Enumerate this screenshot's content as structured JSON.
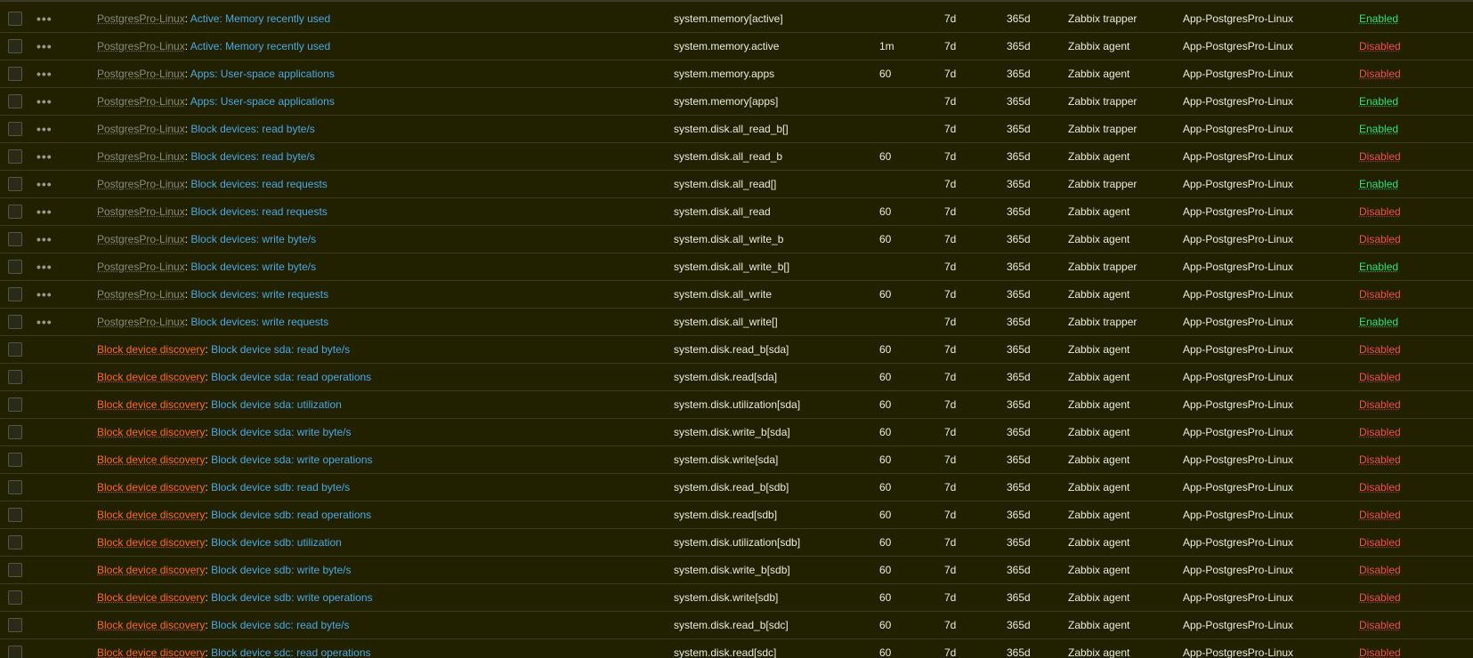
{
  "colors": {
    "background": "#212100",
    "link": "#4ea8e0",
    "discovery": "#ff6a1a",
    "template": "#8a8a80",
    "enabled": "#2ee37a",
    "disabled": "#f24f4f"
  },
  "icons": {
    "row_menu": "ellipsis-icon"
  },
  "rows": [
    {
      "prefix": "PostgresPro-Linux",
      "prefix_kind": "template",
      "has_menu": true,
      "name": "Active: Memory recently used",
      "key": "system.memory[active]",
      "interval": "",
      "history": "7d",
      "trends": "365d",
      "type": "Zabbix trapper",
      "application": "App-PostgresPro-Linux",
      "status": "Enabled"
    },
    {
      "prefix": "PostgresPro-Linux",
      "prefix_kind": "template",
      "has_menu": true,
      "name": "Active: Memory recently used",
      "key": "system.memory.active",
      "interval": "1m",
      "history": "7d",
      "trends": "365d",
      "type": "Zabbix agent",
      "application": "App-PostgresPro-Linux",
      "status": "Disabled"
    },
    {
      "prefix": "PostgresPro-Linux",
      "prefix_kind": "template",
      "has_menu": true,
      "name": "Apps: User-space applications",
      "key": "system.memory.apps",
      "interval": "60",
      "history": "7d",
      "trends": "365d",
      "type": "Zabbix agent",
      "application": "App-PostgresPro-Linux",
      "status": "Disabled"
    },
    {
      "prefix": "PostgresPro-Linux",
      "prefix_kind": "template",
      "has_menu": true,
      "name": "Apps: User-space applications",
      "key": "system.memory[apps]",
      "interval": "",
      "history": "7d",
      "trends": "365d",
      "type": "Zabbix trapper",
      "application": "App-PostgresPro-Linux",
      "status": "Enabled"
    },
    {
      "prefix": "PostgresPro-Linux",
      "prefix_kind": "template",
      "has_menu": true,
      "name": "Block devices: read byte/s",
      "key": "system.disk.all_read_b[]",
      "interval": "",
      "history": "7d",
      "trends": "365d",
      "type": "Zabbix trapper",
      "application": "App-PostgresPro-Linux",
      "status": "Enabled"
    },
    {
      "prefix": "PostgresPro-Linux",
      "prefix_kind": "template",
      "has_menu": true,
      "name": "Block devices: read byte/s",
      "key": "system.disk.all_read_b",
      "interval": "60",
      "history": "7d",
      "trends": "365d",
      "type": "Zabbix agent",
      "application": "App-PostgresPro-Linux",
      "status": "Disabled"
    },
    {
      "prefix": "PostgresPro-Linux",
      "prefix_kind": "template",
      "has_menu": true,
      "name": "Block devices: read requests",
      "key": "system.disk.all_read[]",
      "interval": "",
      "history": "7d",
      "trends": "365d",
      "type": "Zabbix trapper",
      "application": "App-PostgresPro-Linux",
      "status": "Enabled"
    },
    {
      "prefix": "PostgresPro-Linux",
      "prefix_kind": "template",
      "has_menu": true,
      "name": "Block devices: read requests",
      "key": "system.disk.all_read",
      "interval": "60",
      "history": "7d",
      "trends": "365d",
      "type": "Zabbix agent",
      "application": "App-PostgresPro-Linux",
      "status": "Disabled"
    },
    {
      "prefix": "PostgresPro-Linux",
      "prefix_kind": "template",
      "has_menu": true,
      "name": "Block devices: write byte/s",
      "key": "system.disk.all_write_b",
      "interval": "60",
      "history": "7d",
      "trends": "365d",
      "type": "Zabbix agent",
      "application": "App-PostgresPro-Linux",
      "status": "Disabled"
    },
    {
      "prefix": "PostgresPro-Linux",
      "prefix_kind": "template",
      "has_menu": true,
      "name": "Block devices: write byte/s",
      "key": "system.disk.all_write_b[]",
      "interval": "",
      "history": "7d",
      "trends": "365d",
      "type": "Zabbix trapper",
      "application": "App-PostgresPro-Linux",
      "status": "Enabled"
    },
    {
      "prefix": "PostgresPro-Linux",
      "prefix_kind": "template",
      "has_menu": true,
      "name": "Block devices: write requests",
      "key": "system.disk.all_write",
      "interval": "60",
      "history": "7d",
      "trends": "365d",
      "type": "Zabbix agent",
      "application": "App-PostgresPro-Linux",
      "status": "Disabled"
    },
    {
      "prefix": "PostgresPro-Linux",
      "prefix_kind": "template",
      "has_menu": true,
      "name": "Block devices: write requests",
      "key": "system.disk.all_write[]",
      "interval": "",
      "history": "7d",
      "trends": "365d",
      "type": "Zabbix trapper",
      "application": "App-PostgresPro-Linux",
      "status": "Enabled"
    },
    {
      "prefix": "Block device discovery",
      "prefix_kind": "discovery",
      "has_menu": false,
      "name": "Block device sda: read byte/s",
      "key": "system.disk.read_b[sda]",
      "interval": "60",
      "history": "7d",
      "trends": "365d",
      "type": "Zabbix agent",
      "application": "App-PostgresPro-Linux",
      "status": "Disabled"
    },
    {
      "prefix": "Block device discovery",
      "prefix_kind": "discovery",
      "has_menu": false,
      "name": "Block device sda: read operations",
      "key": "system.disk.read[sda]",
      "interval": "60",
      "history": "7d",
      "trends": "365d",
      "type": "Zabbix agent",
      "application": "App-PostgresPro-Linux",
      "status": "Disabled"
    },
    {
      "prefix": "Block device discovery",
      "prefix_kind": "discovery",
      "has_menu": false,
      "name": "Block device sda: utilization",
      "key": "system.disk.utilization[sda]",
      "interval": "60",
      "history": "7d",
      "trends": "365d",
      "type": "Zabbix agent",
      "application": "App-PostgresPro-Linux",
      "status": "Disabled"
    },
    {
      "prefix": "Block device discovery",
      "prefix_kind": "discovery",
      "has_menu": false,
      "name": "Block device sda: write byte/s",
      "key": "system.disk.write_b[sda]",
      "interval": "60",
      "history": "7d",
      "trends": "365d",
      "type": "Zabbix agent",
      "application": "App-PostgresPro-Linux",
      "status": "Disabled"
    },
    {
      "prefix": "Block device discovery",
      "prefix_kind": "discovery",
      "has_menu": false,
      "name": "Block device sda: write operations",
      "key": "system.disk.write[sda]",
      "interval": "60",
      "history": "7d",
      "trends": "365d",
      "type": "Zabbix agent",
      "application": "App-PostgresPro-Linux",
      "status": "Disabled"
    },
    {
      "prefix": "Block device discovery",
      "prefix_kind": "discovery",
      "has_menu": false,
      "name": "Block device sdb: read byte/s",
      "key": "system.disk.read_b[sdb]",
      "interval": "60",
      "history": "7d",
      "trends": "365d",
      "type": "Zabbix agent",
      "application": "App-PostgresPro-Linux",
      "status": "Disabled"
    },
    {
      "prefix": "Block device discovery",
      "prefix_kind": "discovery",
      "has_menu": false,
      "name": "Block device sdb: read operations",
      "key": "system.disk.read[sdb]",
      "interval": "60",
      "history": "7d",
      "trends": "365d",
      "type": "Zabbix agent",
      "application": "App-PostgresPro-Linux",
      "status": "Disabled"
    },
    {
      "prefix": "Block device discovery",
      "prefix_kind": "discovery",
      "has_menu": false,
      "name": "Block device sdb: utilization",
      "key": "system.disk.utilization[sdb]",
      "interval": "60",
      "history": "7d",
      "trends": "365d",
      "type": "Zabbix agent",
      "application": "App-PostgresPro-Linux",
      "status": "Disabled"
    },
    {
      "prefix": "Block device discovery",
      "prefix_kind": "discovery",
      "has_menu": false,
      "name": "Block device sdb: write byte/s",
      "key": "system.disk.write_b[sdb]",
      "interval": "60",
      "history": "7d",
      "trends": "365d",
      "type": "Zabbix agent",
      "application": "App-PostgresPro-Linux",
      "status": "Disabled"
    },
    {
      "prefix": "Block device discovery",
      "prefix_kind": "discovery",
      "has_menu": false,
      "name": "Block device sdb: write operations",
      "key": "system.disk.write[sdb]",
      "interval": "60",
      "history": "7d",
      "trends": "365d",
      "type": "Zabbix agent",
      "application": "App-PostgresPro-Linux",
      "status": "Disabled"
    },
    {
      "prefix": "Block device discovery",
      "prefix_kind": "discovery",
      "has_menu": false,
      "name": "Block device sdc: read byte/s",
      "key": "system.disk.read_b[sdc]",
      "interval": "60",
      "history": "7d",
      "trends": "365d",
      "type": "Zabbix agent",
      "application": "App-PostgresPro-Linux",
      "status": "Disabled"
    },
    {
      "prefix": "Block device discovery",
      "prefix_kind": "discovery",
      "has_menu": false,
      "name": "Block device sdc: read operations",
      "key": "system.disk.read[sdc]",
      "interval": "60",
      "history": "7d",
      "trends": "365d",
      "type": "Zabbix agent",
      "application": "App-PostgresPro-Linux",
      "status": "Disabled"
    }
  ]
}
